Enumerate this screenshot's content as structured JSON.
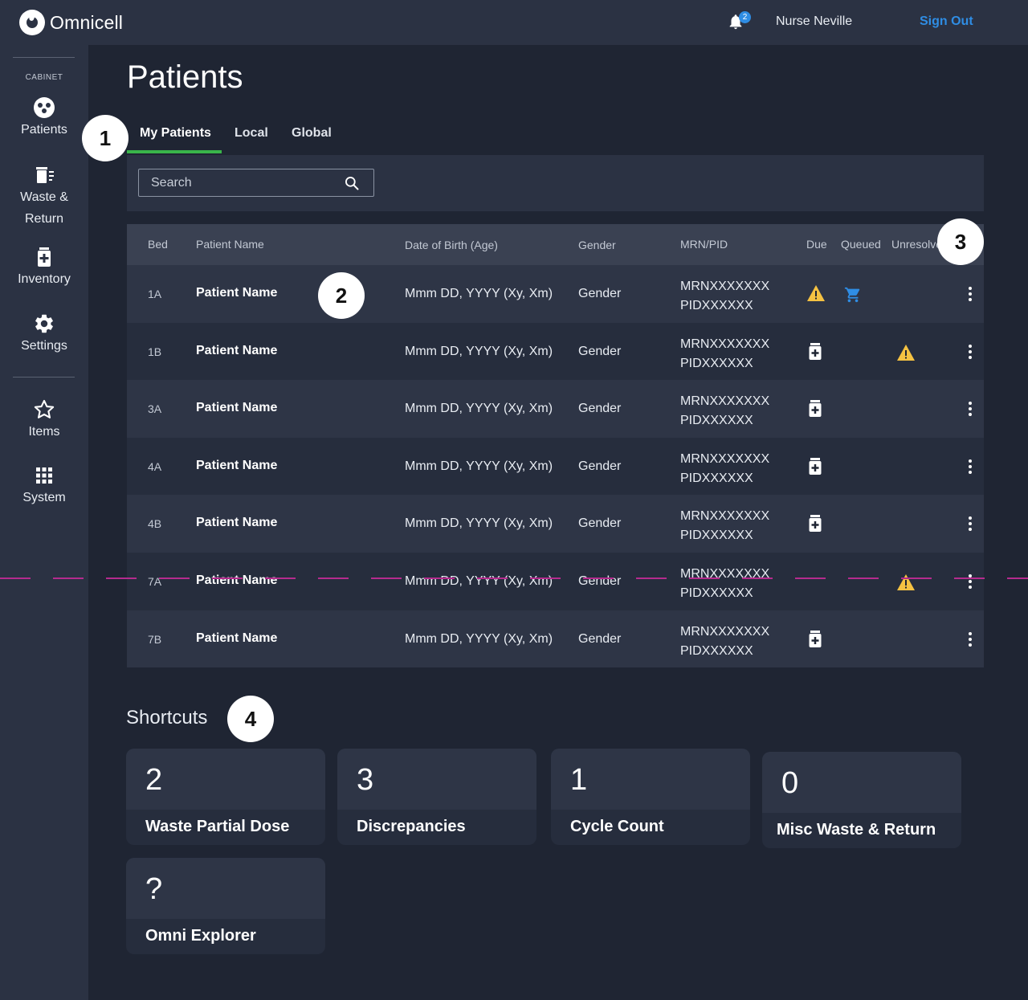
{
  "brand": {
    "name": "Omnicell"
  },
  "header": {
    "notifications_count": "2",
    "user_name": "Nurse Neville",
    "sign_out_label": "Sign Out"
  },
  "sidebar": {
    "caption": "CABINET",
    "items": [
      {
        "label": "Patients",
        "icon": "patients-icon"
      },
      {
        "label": "Waste &\nReturn",
        "icon": "waste-return-icon"
      },
      {
        "label": "Inventory",
        "icon": "inventory-icon"
      },
      {
        "label": "Settings",
        "icon": "gear-icon"
      },
      {
        "label": "Items",
        "icon": "star-icon"
      },
      {
        "label": "System",
        "icon": "grid-icon"
      }
    ]
  },
  "page": {
    "title": "Patients"
  },
  "tabs": [
    {
      "label": "My Patients",
      "active": true
    },
    {
      "label": "Local"
    },
    {
      "label": "Global"
    }
  ],
  "search": {
    "placeholder": "Search"
  },
  "table": {
    "columns": [
      "Bed",
      "Patient Name",
      "Date of Birth (Age)",
      "Gender",
      "MRN/PID",
      "Due",
      "Queued",
      "Unresolved"
    ],
    "rows": [
      {
        "bed": "1A",
        "name": "Patient Name",
        "dob": "Mmm DD, YYYY (Xy, Xm)",
        "gender": "Gender",
        "mrn": "MRNXXXXXXX",
        "pid": "PIDXXXXXX",
        "due": "warning",
        "queued": "cart",
        "unresolved": ""
      },
      {
        "bed": "1B",
        "name": "Patient Name",
        "dob": "Mmm DD, YYYY (Xy, Xm)",
        "gender": "Gender",
        "mrn": "MRNXXXXXXX",
        "pid": "PIDXXXXXX",
        "due": "medication",
        "queued": "",
        "unresolved": "warning"
      },
      {
        "bed": "3A",
        "name": "Patient Name",
        "dob": "Mmm DD, YYYY (Xy, Xm)",
        "gender": "Gender",
        "mrn": "MRNXXXXXXX",
        "pid": "PIDXXXXXX",
        "due": "medication",
        "queued": "",
        "unresolved": ""
      },
      {
        "bed": "4A",
        "name": "Patient Name",
        "dob": "Mmm DD, YYYY (Xy, Xm)",
        "gender": "Gender",
        "mrn": "MRNXXXXXXX",
        "pid": "PIDXXXXXX",
        "due": "medication",
        "queued": "",
        "unresolved": ""
      },
      {
        "bed": "4B",
        "name": "Patient Name",
        "dob": "Mmm DD, YYYY (Xy, Xm)",
        "gender": "Gender",
        "mrn": "MRNXXXXXXX",
        "pid": "PIDXXXXXX",
        "due": "medication",
        "queued": "",
        "unresolved": ""
      },
      {
        "bed": "7A",
        "name": "Patient Name",
        "dob": "Mmm DD, YYYY (Xy, Xm)",
        "gender": "Gender",
        "mrn": "MRNXXXXXXX",
        "pid": "PIDXXXXXX",
        "due": "",
        "queued": "",
        "unresolved": "warning"
      },
      {
        "bed": "7B",
        "name": "Patient Name",
        "dob": "Mmm DD, YYYY (Xy, Xm)",
        "gender": "Gender",
        "mrn": "MRNXXXXXXX",
        "pid": "PIDXXXXXX",
        "due": "medication",
        "queued": "",
        "unresolved": ""
      }
    ]
  },
  "shortcuts": {
    "title": "Shortcuts",
    "cards": [
      {
        "count": "2",
        "label": "Waste Partial Dose"
      },
      {
        "count": "3",
        "label": "Discrepancies"
      },
      {
        "count": "1",
        "label": "Cycle Count"
      },
      {
        "count": "0",
        "label": "Misc Waste & Return"
      },
      {
        "count": "?",
        "label": "Omni Explorer"
      }
    ]
  },
  "callouts": [
    "1",
    "2",
    "3",
    "4"
  ],
  "colors": {
    "accent": "#2f8de4",
    "tab_indicator": "#39b54a",
    "warning": "#f5c242",
    "guide_line": "#b52b8e"
  }
}
